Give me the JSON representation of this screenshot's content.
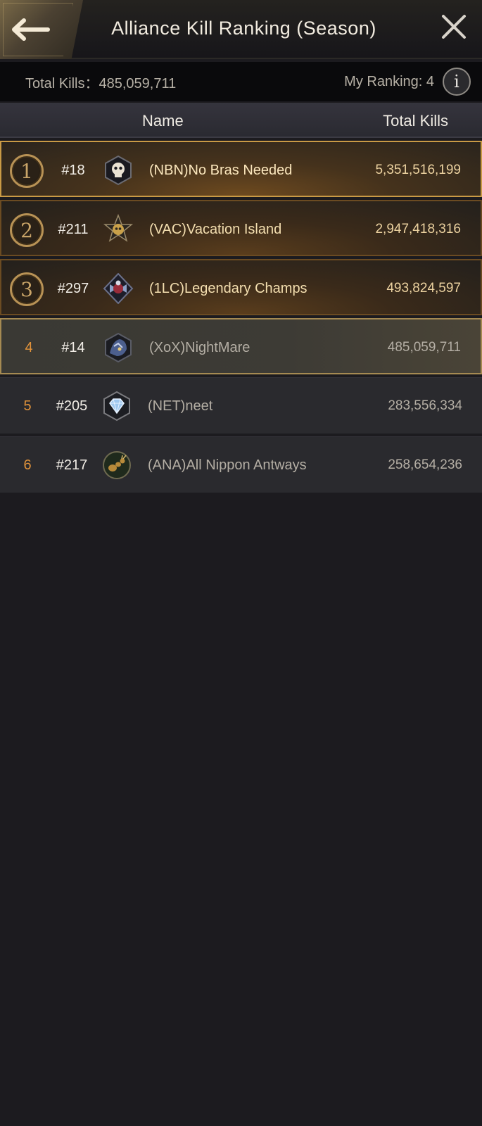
{
  "header": {
    "title": "Alliance Kill Ranking (Season)",
    "back_icon": "arrow-left-icon",
    "close_icon": "close-icon"
  },
  "summary": {
    "total_kills_label": "Total Kills：",
    "total_kills_value": "485,059,711",
    "my_ranking_label": "My Ranking: ",
    "my_ranking_value": "4",
    "info_icon_glyph": "i"
  },
  "columns": {
    "name": "Name",
    "total_kills": "Total Kills"
  },
  "rows": [
    {
      "rank": "1",
      "server": "#18",
      "alliance": "(NBN)No Bras Needed",
      "kills": "5,351,516,199",
      "emblem": "skull-emblem-icon",
      "color": "#2b2b33"
    },
    {
      "rank": "2",
      "server": "#211",
      "alliance": "(VAC)Vacation Island",
      "kills": "2,947,418,316",
      "emblem": "star-skull-emblem-icon",
      "color": "#c9a14a"
    },
    {
      "rank": "3",
      "server": "#297",
      "alliance": "(1LC)Legendary Champs",
      "kills": "493,824,597",
      "emblem": "winged-rider-emblem-icon",
      "color": "#9a2c3a"
    },
    {
      "rank": "4",
      "server": "#14",
      "alliance": "(XoX)NightMare",
      "kills": "485,059,711",
      "emblem": "beast-emblem-icon",
      "color": "#4c5f8e"
    },
    {
      "rank": "5",
      "server": "#205",
      "alliance": "(NET)neet",
      "kills": "283,556,334",
      "emblem": "diamond-emblem-icon",
      "color": "#9fc7ee"
    },
    {
      "rank": "6",
      "server": "#217",
      "alliance": "(ANA)All Nippon Antways",
      "kills": "258,654,236",
      "emblem": "ant-emblem-icon",
      "color": "#b88a3a"
    }
  ],
  "colors": {
    "accent_gold": "#c99a45",
    "rank_orange": "#e0923a",
    "background": "#1c1b1f"
  }
}
